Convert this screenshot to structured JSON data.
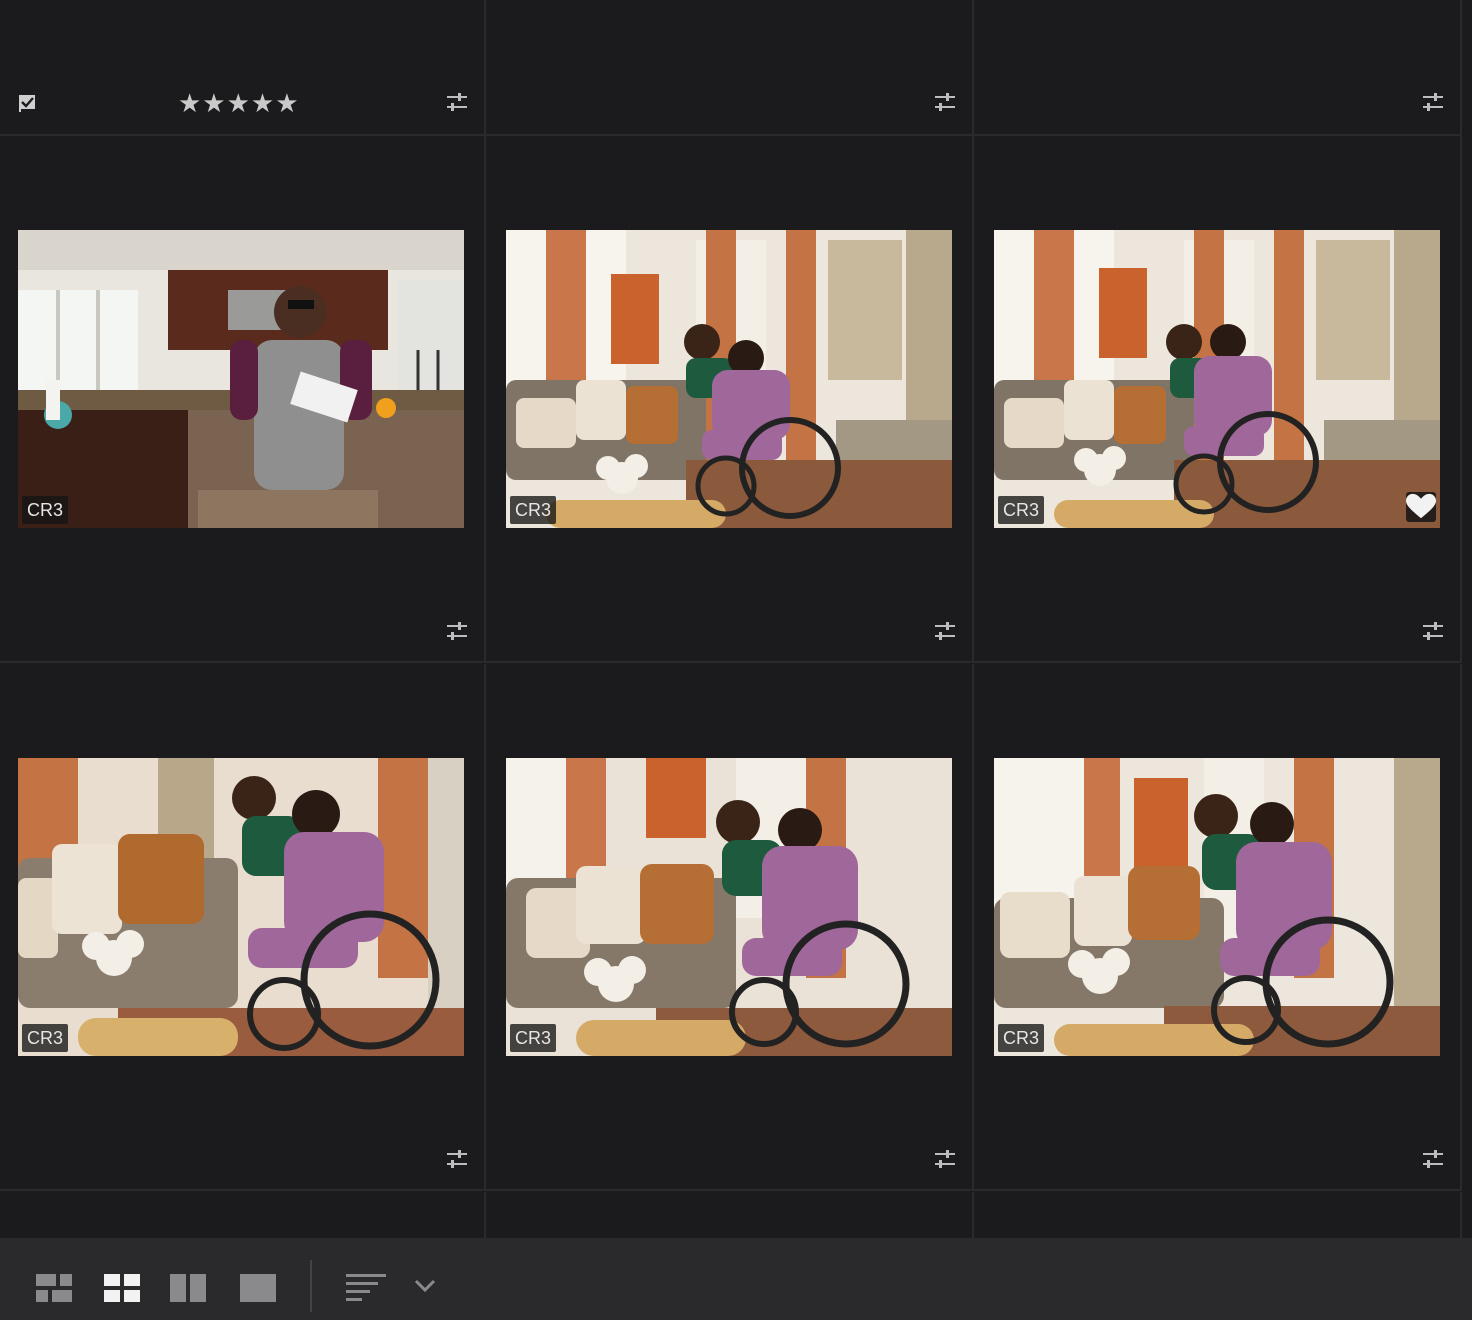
{
  "top_row": {
    "rating_stars": "★★★★★"
  },
  "photos": [
    {
      "format": "CR3",
      "favorite": false,
      "scene": "kitchen-man-phone"
    },
    {
      "format": "CR3",
      "favorite": false,
      "scene": "living-room-wheelchair"
    },
    {
      "format": "CR3",
      "favorite": true,
      "scene": "living-room-wheelchair"
    },
    {
      "format": "CR3",
      "favorite": false,
      "scene": "living-room-wheelchair"
    },
    {
      "format": "CR3",
      "favorite": false,
      "scene": "living-room-wheelchair"
    },
    {
      "format": "CR3",
      "favorite": false,
      "scene": "living-room-wheelchair"
    }
  ],
  "toolbar": {
    "views": [
      "square-grid-icon",
      "photo-grid-icon",
      "compare-icon",
      "detail-icon"
    ],
    "active_view": "photo-grid-icon",
    "sort_icon": "sort-icon",
    "dropdown_icon": "chevron-down-icon"
  },
  "colors": {
    "background": "#1b1b1d",
    "toolbar": "#2a2a2c",
    "divider": "#2a2a2c"
  }
}
